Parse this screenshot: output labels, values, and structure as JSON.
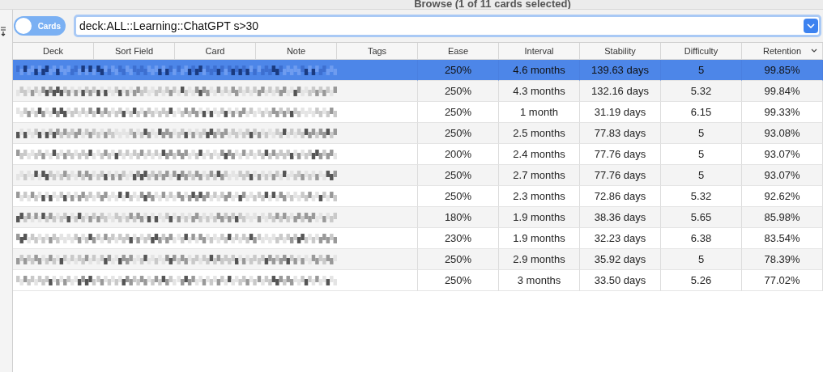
{
  "window": {
    "title": "Browse (1 of 11 cards selected)"
  },
  "mode_toggle": {
    "label": "Cards"
  },
  "search": {
    "value": "deck:ALL::Learning::ChatGPT s>30"
  },
  "table": {
    "columns": [
      {
        "label": "Deck",
        "sorted": false
      },
      {
        "label": "Sort Field",
        "sorted": false
      },
      {
        "label": "Card",
        "sorted": false
      },
      {
        "label": "Note",
        "sorted": false
      },
      {
        "label": "Tags",
        "sorted": false
      },
      {
        "label": "Ease",
        "sorted": false
      },
      {
        "label": "Interval",
        "sorted": false
      },
      {
        "label": "Stability",
        "sorted": false
      },
      {
        "label": "Difficulty",
        "sorted": false
      },
      {
        "label": "Retention",
        "sorted": true
      }
    ],
    "rows": [
      {
        "selected": true,
        "ease": "250%",
        "interval": "4.6 months",
        "stability": "139.63 days",
        "difficulty": "5",
        "retention": "99.85%"
      },
      {
        "selected": false,
        "ease": "250%",
        "interval": "4.3 months",
        "stability": "132.16 days",
        "difficulty": "5.32",
        "retention": "99.84%"
      },
      {
        "selected": false,
        "ease": "250%",
        "interval": "1 month",
        "stability": "31.19 days",
        "difficulty": "6.15",
        "retention": "99.33%"
      },
      {
        "selected": false,
        "ease": "250%",
        "interval": "2.5 months",
        "stability": "77.83 days",
        "difficulty": "5",
        "retention": "93.08%"
      },
      {
        "selected": false,
        "ease": "200%",
        "interval": "2.4 months",
        "stability": "77.76 days",
        "difficulty": "5",
        "retention": "93.07%"
      },
      {
        "selected": false,
        "ease": "250%",
        "interval": "2.7 months",
        "stability": "77.76 days",
        "difficulty": "5",
        "retention": "93.07%"
      },
      {
        "selected": false,
        "ease": "250%",
        "interval": "2.3 months",
        "stability": "72.86 days",
        "difficulty": "5.32",
        "retention": "92.62%"
      },
      {
        "selected": false,
        "ease": "180%",
        "interval": "1.9 months",
        "stability": "38.36 days",
        "difficulty": "5.65",
        "retention": "85.98%"
      },
      {
        "selected": false,
        "ease": "230%",
        "interval": "1.9 months",
        "stability": "32.23 days",
        "difficulty": "6.38",
        "retention": "83.54%"
      },
      {
        "selected": false,
        "ease": "250%",
        "interval": "2.9 months",
        "stability": "35.92 days",
        "difficulty": "5",
        "retention": "78.39%"
      },
      {
        "selected": false,
        "ease": "250%",
        "interval": "3 months",
        "stability": "33.50 days",
        "difficulty": "5.26",
        "retention": "77.02%"
      }
    ]
  }
}
